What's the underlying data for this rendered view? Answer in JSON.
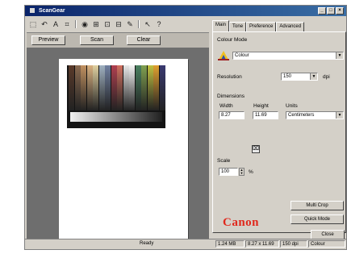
{
  "window": {
    "title": "ScanGear",
    "controls": [
      "_",
      "□",
      "×"
    ]
  },
  "toolbar": {
    "icons": [
      "rect-select-icon",
      "rotate-icon",
      "letter-icon",
      "crop-icon",
      "color-settings-icon",
      "zoom-icon",
      "grid-icon",
      "ruler-icon",
      "eyedropper-icon",
      "arrow-icon",
      "help-icon"
    ],
    "glyphs": [
      "⬚",
      "↶",
      "A",
      "⌗",
      "◉",
      "⊞",
      "⊡",
      "⊟",
      "✎",
      "↖",
      "?"
    ]
  },
  "buttons": {
    "preview": "Preview",
    "scan": "Scan",
    "clear": "Clear"
  },
  "tabs": [
    "Main",
    "Tone",
    "Preference",
    "Advanced"
  ],
  "main": {
    "color_mode_label": "Colour Mode",
    "color_mode_value": "Colour",
    "resolution_label": "Resolution",
    "resolution_value": "150",
    "resolution_unit": "dpi",
    "dimensions_label": "Dimensions",
    "width_label": "Width",
    "height_label": "Height",
    "units_label": "Units",
    "width_value": "8.27",
    "height_value": "11.69",
    "units_value": "Centimeters",
    "scale_label": "Scale",
    "scale_value": "100",
    "scale_unit": "%"
  },
  "panel_buttons": {
    "multi_crop": "Multi Crop",
    "quick_mode": "Quick Mode",
    "close": "Close"
  },
  "brand": "Canon",
  "status": {
    "left": "Ready",
    "cells": [
      "1.24 MB",
      "8.27 x 11.69",
      "150 dpi",
      "Colour"
    ]
  },
  "colors": {
    "title_start": "#0a246a",
    "title_end": "#3a6ea5",
    "face": "#d4d0c8",
    "preview_bg": "#6e6e6e",
    "brand": "#e0281c"
  }
}
